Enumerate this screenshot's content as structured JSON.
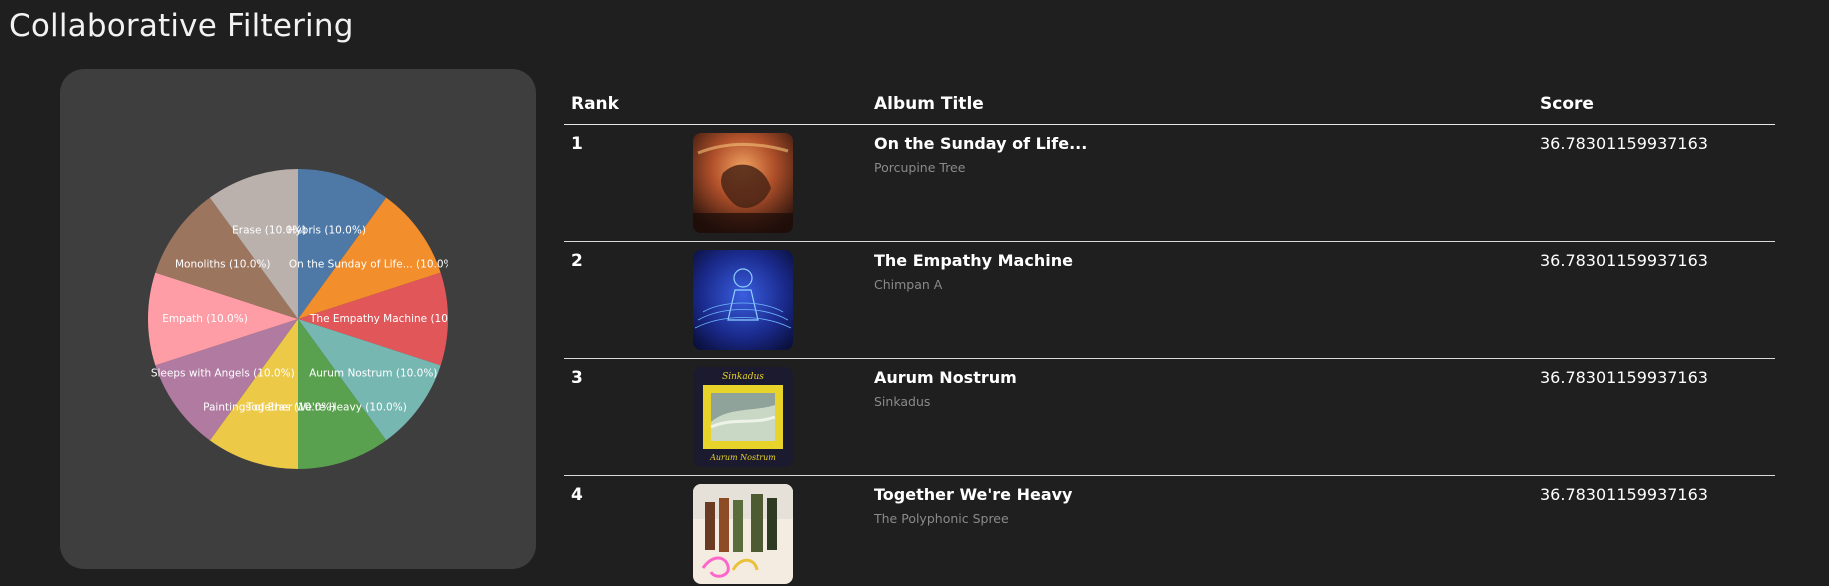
{
  "page": {
    "title": "Collaborative Filtering"
  },
  "chart_data": {
    "type": "pie",
    "slices": [
      {
        "label": "Hybris",
        "value": 10,
        "color": "#4e79a7"
      },
      {
        "label": "On the Sunday of Life...",
        "value": 10,
        "color": "#f28e2b"
      },
      {
        "label": "The Empathy Machine",
        "value": 10,
        "color": "#e15759"
      },
      {
        "label": "Aurum Nostrum",
        "value": 10,
        "color": "#76b7b2"
      },
      {
        "label": "Together We're Heavy",
        "value": 10,
        "color": "#59a14f"
      },
      {
        "label": "Paintings of Eras",
        "value": 10,
        "color": "#edc948"
      },
      {
        "label": "Sleeps with Angels",
        "value": 10,
        "color": "#b07aa1"
      },
      {
        "label": "Empath",
        "value": 10,
        "color": "#ff9da7"
      },
      {
        "label": "Monoliths",
        "value": 10,
        "color": "#9c755f"
      },
      {
        "label": "Erase",
        "value": 10,
        "color": "#bab0ac"
      }
    ],
    "label_format": "{label} ({pct}%)"
  },
  "table": {
    "headers": {
      "rank": "Rank",
      "title": "Album Title",
      "score": "Score"
    },
    "rows": [
      {
        "rank": "1",
        "title": "On the Sunday of Life...",
        "artist": "Porcupine Tree",
        "score": "36.78301159937163"
      },
      {
        "rank": "2",
        "title": "The Empathy Machine",
        "artist": "Chimpan A",
        "score": "36.78301159937163"
      },
      {
        "rank": "3",
        "title": "Aurum Nostrum",
        "artist": "Sinkadus",
        "score": "36.78301159937163"
      },
      {
        "rank": "4",
        "title": "Together We're Heavy",
        "artist": "The Polyphonic Spree",
        "score": "36.78301159937163"
      }
    ],
    "cover_text": {
      "row3_top": "Sinkadus",
      "row3_bottom": "Aurum Nostrum"
    }
  }
}
